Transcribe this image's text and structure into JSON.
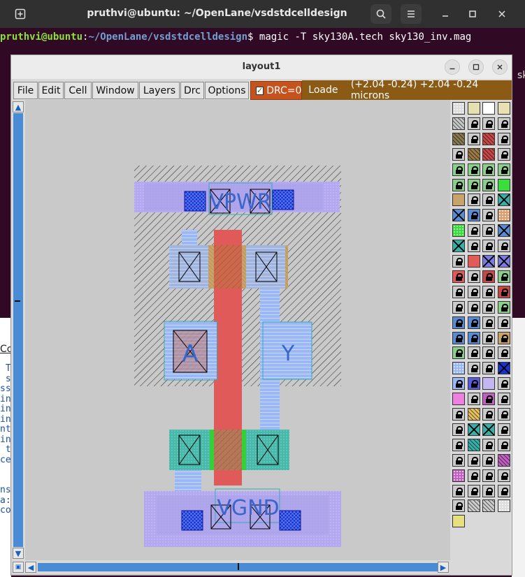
{
  "terminal": {
    "title": "pruthvi@ubuntu: ~/OpenLane/vsdstdcelldesign",
    "prompt_user": "pruthvi@ubuntu",
    "prompt_sep": ":",
    "prompt_path": "~/OpenLane/vsdstdcelldesign",
    "prompt_dollar": "$ ",
    "command": "magic -T sky130A.tech sky130_inv.mag",
    "header_icons": [
      "new-tab-icon",
      "search-icon",
      "menu-icon",
      "minimize-icon",
      "maximize-icon",
      "close-icon"
    ]
  },
  "background_fragments": {
    "left_lines": [
      " T",
      " s",
      "ss",
      "in",
      "in",
      "in",
      "nt",
      "in",
      " t",
      "ce",
      "",
      "",
      "ns",
      "a:",
      "co"
    ],
    "left_co": "Co",
    "right_text": "sk"
  },
  "magic": {
    "window_title": "layout1",
    "menus": [
      "File",
      "Edit",
      "Cell",
      "Window",
      "Layers",
      "Drc",
      "Options"
    ],
    "drc_label": "DRC=0",
    "drc_checked": true,
    "status_text": "Loade",
    "coords_text": "(+2.04 -0.24) +2.04 -0.24 microns",
    "labels": {
      "vpwr": "VPWR",
      "vgnd": "VGND",
      "a": "A",
      "y": "Y"
    }
  },
  "colors": {
    "terminal_bg": "#300a24",
    "drc_bg": "#c4531d",
    "status_bg": "#8b5a14",
    "poly": "#e05a5a",
    "metal1": "#a8a0e8",
    "locali": "#8fb6ff",
    "ndiff": "#3aaea6",
    "scroll": "#4a8bd6"
  }
}
